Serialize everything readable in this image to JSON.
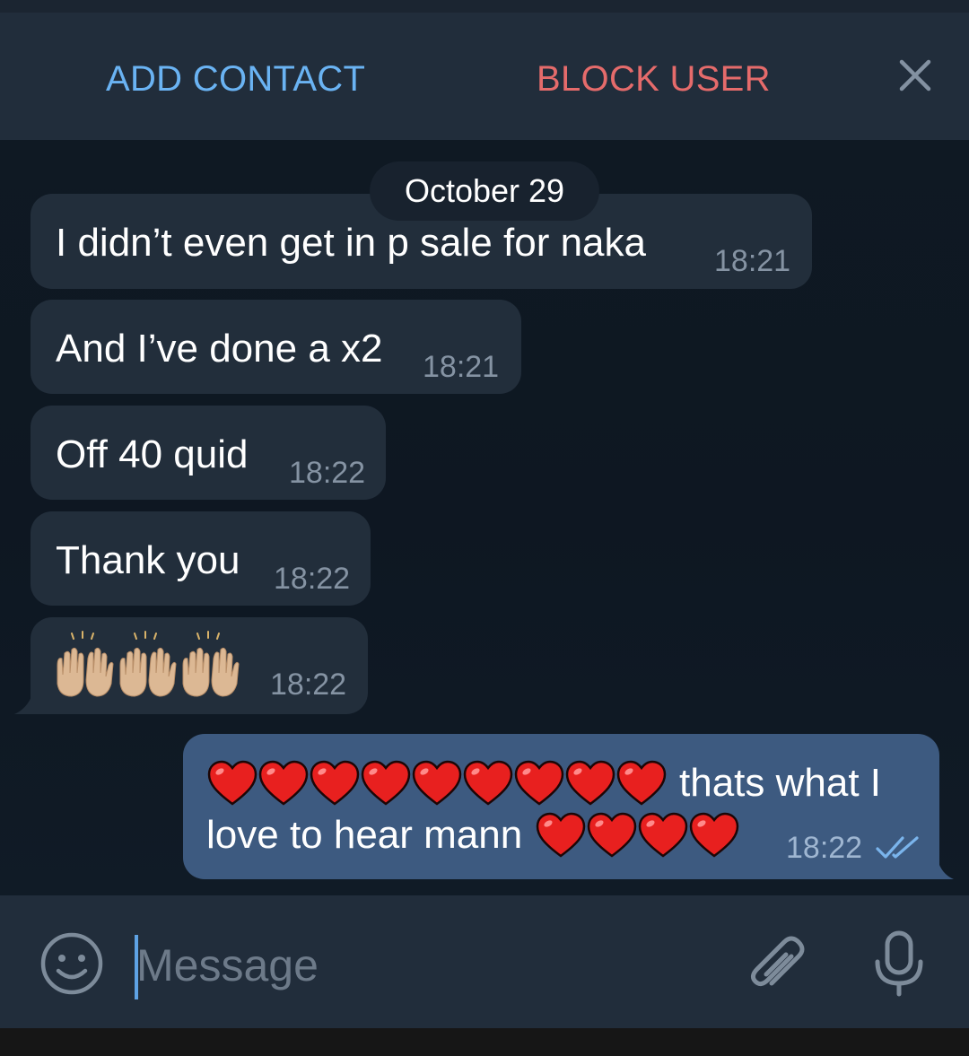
{
  "header": {
    "add_contact_label": "ADD CONTACT",
    "block_user_label": "BLOCK USER",
    "close_icon": "close-icon"
  },
  "chat": {
    "date_label": "October 29",
    "messages": [
      {
        "direction": "incoming",
        "text": "I didn’t even get in p sale for naka",
        "time": "18:21"
      },
      {
        "direction": "incoming",
        "text": "And I’ve done a x2",
        "time": "18:21"
      },
      {
        "direction": "incoming",
        "text": "Off 40 quid",
        "time": "18:22"
      },
      {
        "direction": "incoming",
        "text": "Thank you",
        "time": "18:22"
      },
      {
        "direction": "incoming",
        "text": "🙌🏼🙌🏼🙌🏼",
        "emoji": "raising-hands-medium-light",
        "time": "18:22"
      },
      {
        "direction": "outgoing",
        "text": "❤️❤️❤️❤️❤️❤️❤️❤️❤️ thats what I love to hear mann ❤️❤️❤️❤️",
        "text_line1": "thats what I",
        "text_line2": "love to hear mann",
        "time": "18:22",
        "status": "read-double-check"
      }
    ]
  },
  "input": {
    "placeholder": "Message",
    "value": ""
  },
  "icons": [
    "smile-icon",
    "attach-icon",
    "microphone-icon"
  ],
  "colors": {
    "header_bg": "#212d3b",
    "chat_bg": "#0e1621",
    "incoming_bubble": "#222e3b",
    "outgoing_bubble": "#3d5a80",
    "add_contact": "#6ab3f3",
    "block_user": "#e56b6b",
    "time_text": "#8593a3"
  }
}
